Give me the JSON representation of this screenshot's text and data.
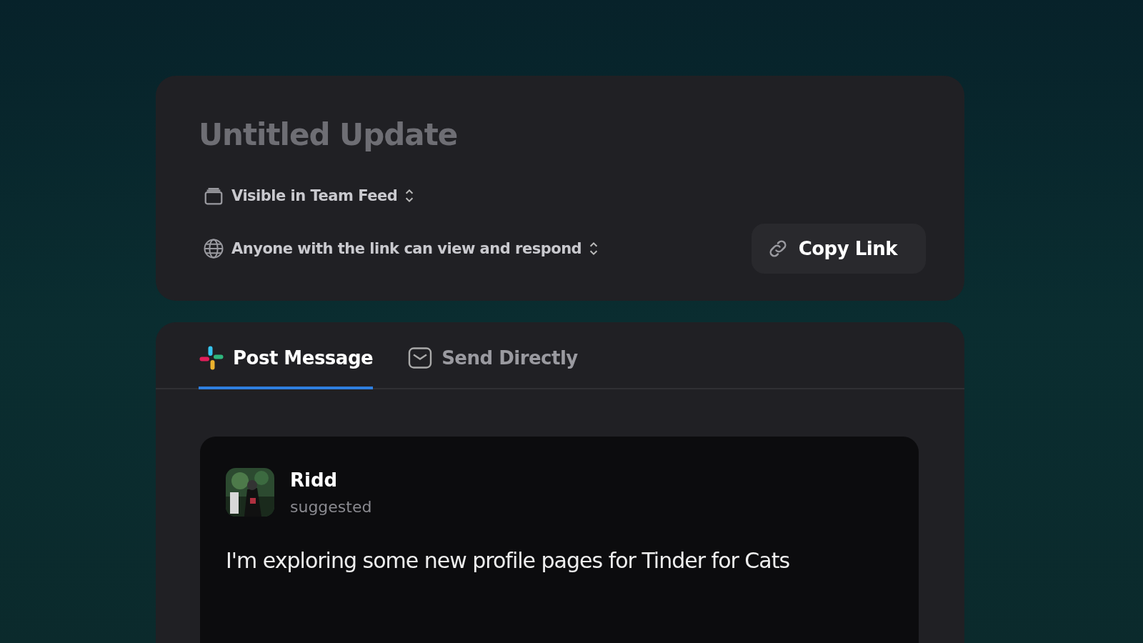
{
  "update": {
    "title": "Untitled Update",
    "visibility": "Visible in Team Feed",
    "access": "Anyone with the link can view and respond",
    "copy_button": "Copy Link"
  },
  "tabs": [
    {
      "label": "Post Message",
      "selected": true,
      "kind": "pinwheel"
    },
    {
      "label": "Send Directly",
      "selected": false,
      "kind": "mail"
    }
  ],
  "message": {
    "author": "Ridd",
    "status": "suggested",
    "text": "I'm exploring some new profile pages for Tinder for Cats"
  }
}
